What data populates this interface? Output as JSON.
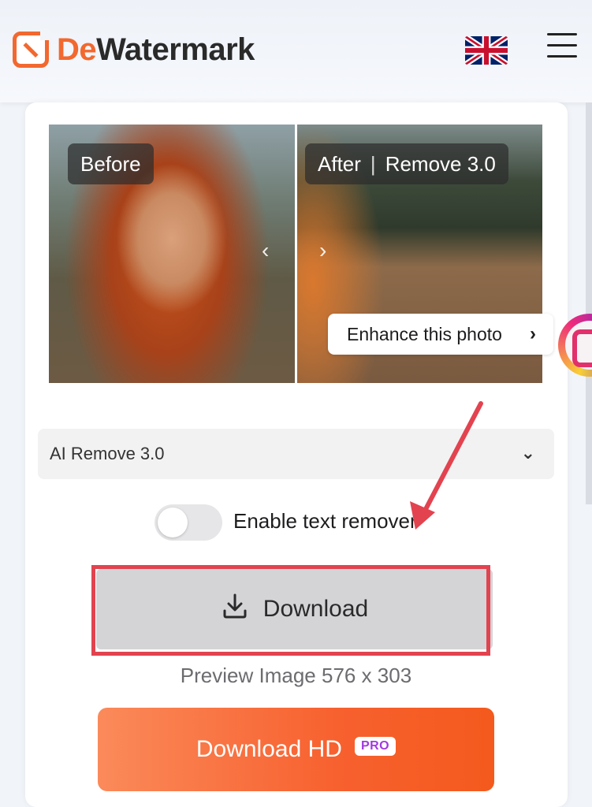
{
  "header": {
    "brand_prefix": "De",
    "brand_suffix": "Watermark",
    "language_flag": "uk-flag-icon",
    "menu_icon": "hamburger-menu-icon"
  },
  "comparison": {
    "before_label": "Before",
    "after_label": "After",
    "after_model": "Remove 3.0",
    "enhance_label": "Enhance this photo"
  },
  "model_select": {
    "value": "AI Remove 3.0"
  },
  "text_remover": {
    "label": "Enable text remover",
    "enabled": false
  },
  "download": {
    "label": "Download",
    "preview_info": "Preview Image 576 x 303"
  },
  "download_hd": {
    "label": "Download HD",
    "badge": "PRO"
  },
  "colors": {
    "brand": "#f2682f",
    "highlight": "#e2434f",
    "pro_badge": "#a23ae0"
  }
}
